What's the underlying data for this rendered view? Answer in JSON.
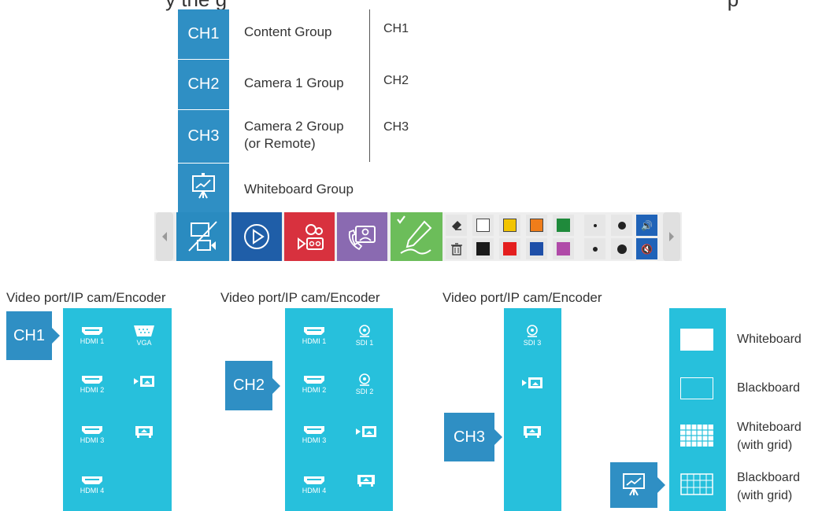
{
  "header_partial": "y the g                                                                                        p                 p",
  "groups": [
    {
      "tile": "CH1",
      "label": "Content Group",
      "channel": "CH1"
    },
    {
      "tile": "CH2",
      "label": "Camera 1 Group",
      "channel": "CH2"
    },
    {
      "tile": "CH3",
      "label_line1": "Camera 2 Group",
      "label_line2": "(or Remote)",
      "channel": "CH3"
    },
    {
      "label": "Whiteboard Group"
    }
  ],
  "toolbar": {
    "buttons": [
      "layout-camera-icon",
      "play-icon",
      "record-icon",
      "call-contact-icon",
      "pen-icon"
    ],
    "colors_row1": [
      "#ffffff",
      "#f2c400",
      "#ef7d1a",
      "#1f8a3b"
    ],
    "colors_row2": [
      "#1a1a1a",
      "#e41e1e",
      "#1e4fa8",
      "#b04aa8"
    ],
    "volume_on": "🔊",
    "volume_off": "🔇"
  },
  "captions": {
    "col1": "Video port/IP cam/Encoder",
    "col2": "Video port/IP cam/Encoder",
    "col3": "Video port/IP cam/Encoder"
  },
  "panel1": {
    "badge": "CH1",
    "ports": [
      "HDMI 1",
      "VGA",
      "HDMI 2",
      "HDMI 3",
      "HDMI 4"
    ]
  },
  "panel2": {
    "badge": "CH2",
    "ports": [
      "HDMI 1",
      "SDI 1",
      "HDMI 2",
      "SDI 2",
      "HDMI 3",
      "HDMI 4"
    ]
  },
  "panel3": {
    "badge": "CH3",
    "ports": [
      "SDI 3"
    ]
  },
  "boards": [
    {
      "line1": "Whiteboard"
    },
    {
      "line1": "Blackboard"
    },
    {
      "line1": "Whiteboard",
      "line2": "(with grid)"
    },
    {
      "line1": "Blackboard",
      "line2": "(with grid)"
    }
  ]
}
